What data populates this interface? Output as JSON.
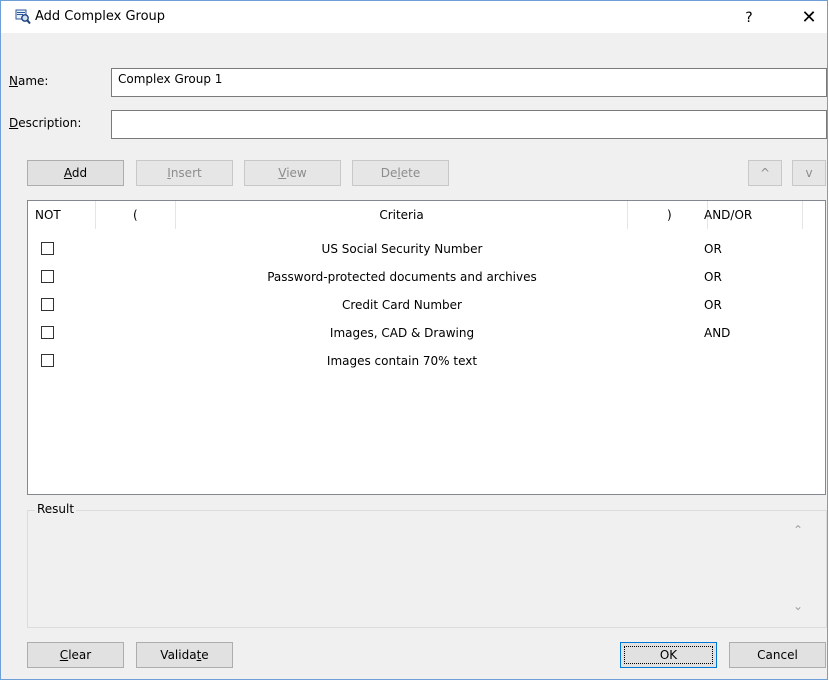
{
  "window": {
    "title": "Add Complex Group",
    "help_label": "?",
    "close_label": "✕"
  },
  "form": {
    "name_label": "Name:",
    "name_value": "Complex Group 1",
    "description_label": "Description:",
    "description_value": ""
  },
  "toolbar": {
    "add": "Add",
    "insert": "Insert",
    "view": "View",
    "delete": "Delete",
    "up": "^",
    "down": "v"
  },
  "grid": {
    "columns": [
      "NOT",
      "(",
      "Criteria",
      ")",
      "AND/OR"
    ],
    "rows": [
      {
        "not": false,
        "open": "",
        "criteria": "US Social Security Number",
        "close": "",
        "andor": "OR"
      },
      {
        "not": false,
        "open": "",
        "criteria": "Password-protected documents and archives",
        "close": "",
        "andor": "OR"
      },
      {
        "not": false,
        "open": "",
        "criteria": "Credit Card Number",
        "close": "",
        "andor": "OR"
      },
      {
        "not": false,
        "open": "",
        "criteria": "Images, CAD & Drawing",
        "close": "",
        "andor": "AND"
      },
      {
        "not": false,
        "open": "",
        "criteria": "Images contain 70% text",
        "close": "",
        "andor": ""
      }
    ]
  },
  "result": {
    "label": "Result",
    "text": ""
  },
  "footer": {
    "clear": "Clear",
    "validate": "Validate",
    "ok": "OK",
    "cancel": "Cancel"
  }
}
